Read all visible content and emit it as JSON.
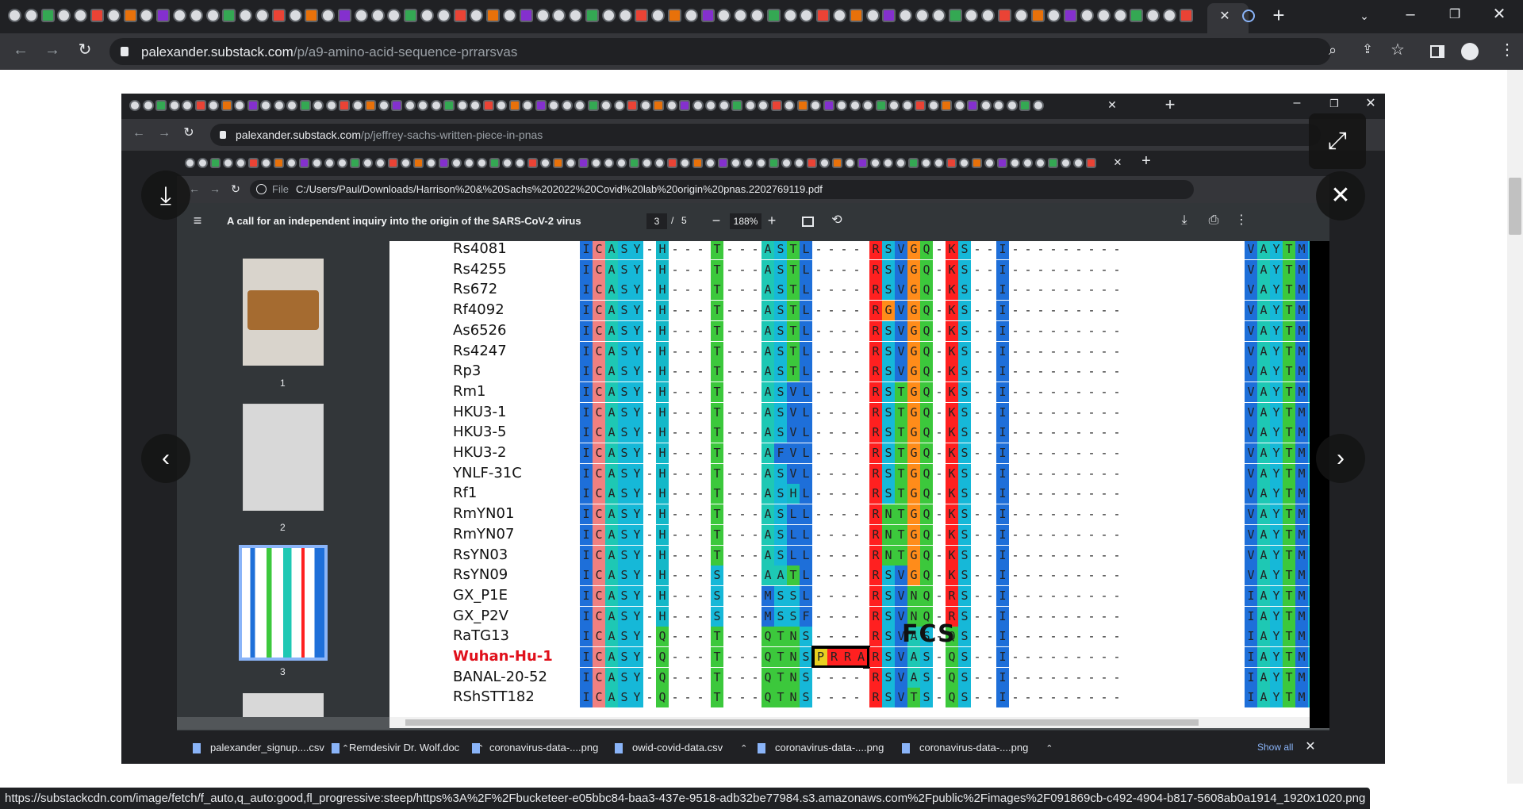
{
  "outer_browser": {
    "url_host": "palexander.substack.com",
    "url_path": "/p/a9-amino-acid-sequence-prrarsvas",
    "new_tab": "+",
    "close_tab": "✕"
  },
  "inner_browser": {
    "url_host": "palexander.substack.com",
    "url_path": "/p/jeffrey-sachs-written-piece-in-pnas"
  },
  "pdf_browser": {
    "file_label": "File",
    "url": "C:/Users/Paul/Downloads/Harrison%20&%20Sachs%202022%20Covid%20lab%20origin%20pnas.2202769119.pdf",
    "doc_title": "A call for an independent inquiry into the origin of the SARS-CoV-2 virus",
    "page_current": "3",
    "page_sep": "/",
    "page_total": "5",
    "zoom": "188%"
  },
  "thumbnails": [
    {
      "label": "1"
    },
    {
      "label": "2"
    },
    {
      "label": "3"
    }
  ],
  "alignment": {
    "fcs_label": "FCS",
    "rows": [
      {
        "name": "Rs4081",
        "a": "ICASY-H",
        "b": "T",
        "c": "ASTL",
        "d": "RSVGQ",
        "e": "KS",
        "f": "VAYTMS"
      },
      {
        "name": "Rs4255",
        "a": "ICASY-H",
        "b": "T",
        "c": "ASTL",
        "d": "RSVGQ",
        "e": "KS",
        "f": "VAYTMS"
      },
      {
        "name": "Rs672",
        "a": "ICASY-H",
        "b": "T",
        "c": "ASTL",
        "d": "RSVGQ",
        "e": "KS",
        "f": "VAYTMS"
      },
      {
        "name": "Rf4092",
        "a": "ICASY-H",
        "b": "T",
        "c": "ASTL",
        "d": "RGVGQ",
        "e": "KS",
        "f": "VAYTMS"
      },
      {
        "name": "As6526",
        "a": "ICASY-H",
        "b": "T",
        "c": "ASTL",
        "d": "RSVGQ",
        "e": "KS",
        "f": "VAYTMS"
      },
      {
        "name": "Rs4247",
        "a": "ICASY-H",
        "b": "T",
        "c": "ASTL",
        "d": "RSVGQ",
        "e": "KS",
        "f": "VAYTMS"
      },
      {
        "name": "Rp3",
        "a": "ICASY-H",
        "b": "T",
        "c": "ASTL",
        "d": "RSVGQ",
        "e": "KS",
        "f": "VAYTMS"
      },
      {
        "name": "Rm1",
        "a": "ICASY-H",
        "b": "T",
        "c": "ASVL",
        "d": "RSTGQ",
        "e": "KS",
        "f": "VAYTMS"
      },
      {
        "name": "HKU3-1",
        "a": "ICASY-H",
        "b": "T",
        "c": "ASVL",
        "d": "RSTGQ",
        "e": "KS",
        "f": "VAYTMS"
      },
      {
        "name": "HKU3-5",
        "a": "ICASY-H",
        "b": "T",
        "c": "ASVL",
        "d": "RSTGQ",
        "e": "KS",
        "f": "VAYTMS"
      },
      {
        "name": "HKU3-2",
        "a": "ICASY-H",
        "b": "T",
        "c": "AFVL",
        "d": "RSTGQ",
        "e": "KS",
        "f": "VAYTMS"
      },
      {
        "name": "YNLF-31C",
        "a": "ICASY-H",
        "b": "T",
        "c": "ASVL",
        "d": "RSTGQ",
        "e": "KS",
        "f": "VAYTMS"
      },
      {
        "name": "Rf1",
        "a": "ICASY-H",
        "b": "T",
        "c": "ASHL",
        "d": "RSTGQ",
        "e": "KS",
        "f": "VAYTMS"
      },
      {
        "name": "RmYN01",
        "a": "ICASY-H",
        "b": "T",
        "c": "ASLL",
        "d": "RNTGQ",
        "e": "KS",
        "f": "VAYTMS"
      },
      {
        "name": "RmYN07",
        "a": "ICASY-H",
        "b": "T",
        "c": "ASLL",
        "d": "RNTGQ",
        "e": "KS",
        "f": "VAYTMS"
      },
      {
        "name": "RsYN03",
        "a": "ICASY-H",
        "b": "T",
        "c": "ASLL",
        "d": "RNTGQ",
        "e": "KS",
        "f": "VAYTMS"
      },
      {
        "name": "RsYN09",
        "a": "ICASY-H",
        "b": "S",
        "c": "AATL",
        "d": "RSVGQ",
        "e": "KS",
        "f": "VAYTMS"
      },
      {
        "name": "GX_P1E",
        "a": "ICASY-H",
        "b": "S",
        "c": "MSSL",
        "d": "RSVNQ",
        "e": "RS",
        "f": "IAYTMS"
      },
      {
        "name": "GX_P2V",
        "a": "ICASY-H",
        "b": "S",
        "c": "MSSF",
        "d": "RSVNQ",
        "e": "RS",
        "f": "IAYTMS"
      },
      {
        "name": "RaTG13",
        "a": "ICASY-Q",
        "b": "T",
        "c": "QTNS",
        "d": "RSVAS",
        "e": "QS",
        "f": "IAYTMS"
      },
      {
        "name": "Wuhan-Hu-1",
        "a": "ICASY-Q",
        "b": "T",
        "c": "QTNS",
        "ins": "PRRA",
        "d": "RSVAS",
        "e": "QS",
        "f": "IAYTMS",
        "highlight": true
      },
      {
        "name": "BANAL-20-52",
        "a": "ICASY-Q",
        "b": "T",
        "c": "QTNS",
        "d": "RSVAS",
        "e": "QS",
        "f": "IAYTMS"
      },
      {
        "name": "RShSTT182",
        "a": "ICASY-Q",
        "b": "T",
        "c": "QTNS",
        "d": "RSVTS",
        "e": "QS",
        "f": "IAYTMS"
      }
    ]
  },
  "downloads": [
    {
      "name": "palexander_signup....csv"
    },
    {
      "name": "Remdesivir Dr. Wolf.doc"
    },
    {
      "name": "coronavirus-data-....png"
    },
    {
      "name": "owid-covid-data.csv"
    },
    {
      "name": "coronavirus-data-....png"
    },
    {
      "name": "coronavirus-data-....png"
    }
  ],
  "show_all": "Show all",
  "status_url": "https://substackcdn.com/image/fetch/f_auto,q_auto:good,fl_progressive:steep/https%3A%2F%2Fbucketeer-e05bbc84-baa3-437e-9518-adb32be77984.s3.amazonaws.com%2Fpublic%2Fimages%2F091869cb-c492-4904-b817-5608ab0a1914_1920x1020.png",
  "colors": {
    "I": "#1e6fd9",
    "C": "#f08080",
    "A": "#1ec8b4",
    "S": "#16b8d8",
    "Y": "#16b8d8",
    "H": "#14b8c8",
    "Q": "#3cc83c",
    "T": "#3cc83c",
    "L": "#1e6fd9",
    "V": "#1e6fd9",
    "R": "#ff2020",
    "G": "#ff8c1a",
    "K": "#ff2020",
    "N": "#3cc83c",
    "F": "#1e6fd9",
    "M": "#1e6fd9",
    "P": "#e8d020",
    "dash": "#ffffff"
  }
}
